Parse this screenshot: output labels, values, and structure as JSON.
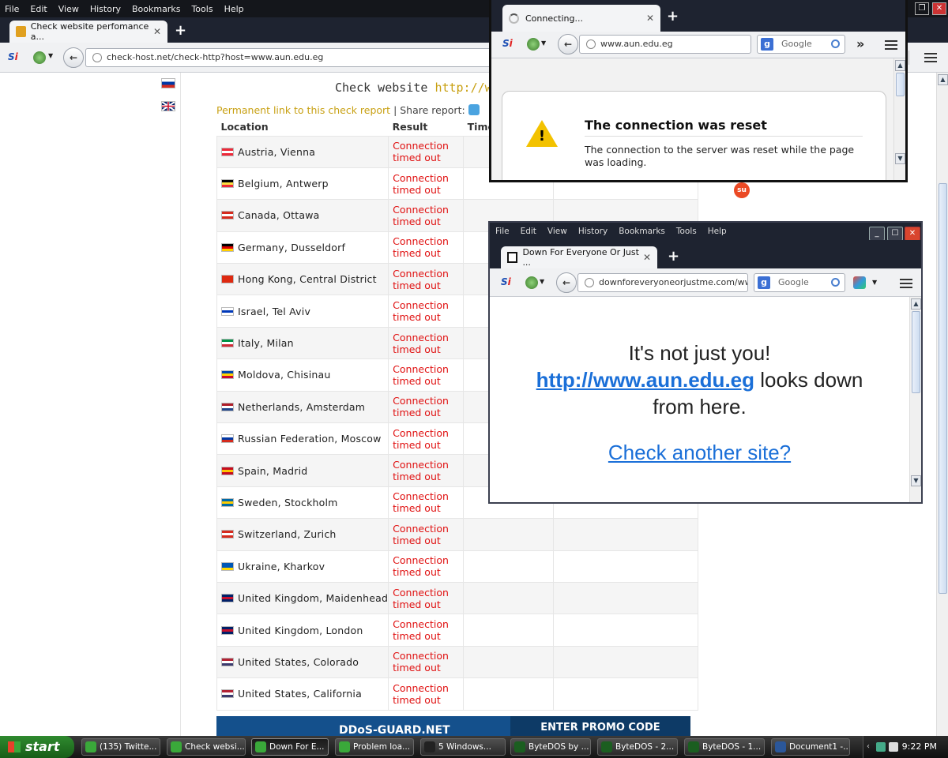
{
  "main_window": {
    "menu": [
      "File",
      "Edit",
      "View",
      "History",
      "Bookmarks",
      "Tools",
      "Help"
    ],
    "tab_title": "Check website perfomance a...",
    "url": "check-host.net/check-http?host=www.aun.edu.eg",
    "heading_prefix": "Check website ",
    "heading_link": "http://ww",
    "permalink_text": "Permanent link to this check report",
    "share_text": " | Share report:",
    "table_headers": {
      "location": "Location",
      "result": "Result",
      "time": "Time"
    },
    "rows": [
      {
        "location": "Austria, Vienna",
        "result": "Connection timed out",
        "flag": [
          "#ed2939",
          "#ffffff",
          "#ed2939"
        ]
      },
      {
        "location": "Belgium, Antwerp",
        "result": "Connection timed out",
        "flag": [
          "#000000",
          "#fae042",
          "#ed2939"
        ]
      },
      {
        "location": "Canada, Ottawa",
        "result": "Connection timed out",
        "flag": [
          "#d52b1e",
          "#ffffff",
          "#d52b1e"
        ]
      },
      {
        "location": "Germany, Dusseldorf",
        "result": "Connection timed out",
        "flag": [
          "#000000",
          "#dd0000",
          "#ffce00"
        ]
      },
      {
        "location": "Hong Kong, Central District",
        "result": "Connection timed out",
        "flag": [
          "#de2910",
          "#de2910",
          "#de2910"
        ]
      },
      {
        "location": "Israel, Tel Aviv",
        "result": "Connection timed out",
        "flag": [
          "#ffffff",
          "#0038b8",
          "#ffffff"
        ]
      },
      {
        "location": "Italy, Milan",
        "result": "Connection timed out",
        "flag": [
          "#009246",
          "#ffffff",
          "#ce2b37"
        ]
      },
      {
        "location": "Moldova, Chisinau",
        "result": "Connection timed out",
        "flag": [
          "#0046ae",
          "#ffd200",
          "#cc092f"
        ]
      },
      {
        "location": "Netherlands, Amsterdam",
        "result": "Connection timed out",
        "flag": [
          "#ae1c28",
          "#ffffff",
          "#21468b"
        ]
      },
      {
        "location": "Russian Federation, Moscow",
        "result": "Connection timed out",
        "flag": [
          "#ffffff",
          "#0039a6",
          "#d52b1e"
        ]
      },
      {
        "location": "Spain, Madrid",
        "result": "Connection timed out",
        "flag": [
          "#c60b1e",
          "#ffc400",
          "#c60b1e"
        ]
      },
      {
        "location": "Sweden, Stockholm",
        "result": "Connection timed out",
        "flag": [
          "#006aa7",
          "#fecc00",
          "#006aa7"
        ]
      },
      {
        "location": "Switzerland, Zurich",
        "result": "Connection timed out",
        "flag": [
          "#d52b1e",
          "#ffffff",
          "#d52b1e"
        ]
      },
      {
        "location": "Ukraine, Kharkov",
        "result": "Connection timed out",
        "flag": [
          "#0057b7",
          "#0057b7",
          "#ffd700"
        ]
      },
      {
        "location": "United Kingdom, Maidenhead",
        "result": "Connection timed out",
        "flag": [
          "#012169",
          "#c8102e",
          "#012169"
        ]
      },
      {
        "location": "United Kingdom, London",
        "result": "Connection timed out",
        "flag": [
          "#012169",
          "#c8102e",
          "#012169"
        ]
      },
      {
        "location": "United States, Colorado",
        "result": "Connection timed out",
        "flag": [
          "#b22234",
          "#ffffff",
          "#3c3b6e"
        ]
      },
      {
        "location": "United States, California",
        "result": "Connection timed out",
        "flag": [
          "#b22234",
          "#ffffff",
          "#3c3b6e"
        ]
      }
    ],
    "banner_left": "DDoS-GUARD.NET",
    "banner_right": "ENTER PROMO CODE"
  },
  "popup1": {
    "tab_title": "Connecting...",
    "url": "www.aun.edu.eg",
    "search_placeholder": "Google",
    "error_title": "The connection was reset",
    "error_desc": "The connection to the server was reset while the page was loading."
  },
  "popup2": {
    "menu": [
      "File",
      "Edit",
      "View",
      "History",
      "Bookmarks",
      "Tools",
      "Help"
    ],
    "tab_title": "Down For Everyone Or Just ...",
    "url": "downforeveryoneorjustme.com/ww",
    "search_placeholder": "Google",
    "msg_line1": "It's not just you!",
    "msg_link": "http://www.aun.edu.eg",
    "msg_line2_rest": " looks down",
    "msg_line3": "from here.",
    "check_another": "Check another site?"
  },
  "taskbar": {
    "start_label": "start",
    "tasks": [
      {
        "label": "(135) Twitte...",
        "icon_color": "#3aa83a"
      },
      {
        "label": "Check websi...",
        "icon_color": "#3aa83a"
      },
      {
        "label": "Down For E...",
        "icon_color": "#3aa83a"
      },
      {
        "label": "Problem loa...",
        "icon_color": "#3aa83a"
      },
      {
        "label": "5 Windows...",
        "icon_color": "#222222"
      },
      {
        "label": "ByteDOS by ...",
        "icon_color": "#1b5e20"
      },
      {
        "label": "ByteDOS - 2...",
        "icon_color": "#1b5e20"
      },
      {
        "label": "ByteDOS - 1...",
        "icon_color": "#1b5e20"
      },
      {
        "label": "Document1 -...",
        "icon_color": "#2b579a"
      }
    ],
    "clock": "9:22 PM"
  },
  "colors": {
    "accent_gold": "#c8a012",
    "error_red": "#e01010",
    "link_blue": "#1a6fd8"
  }
}
